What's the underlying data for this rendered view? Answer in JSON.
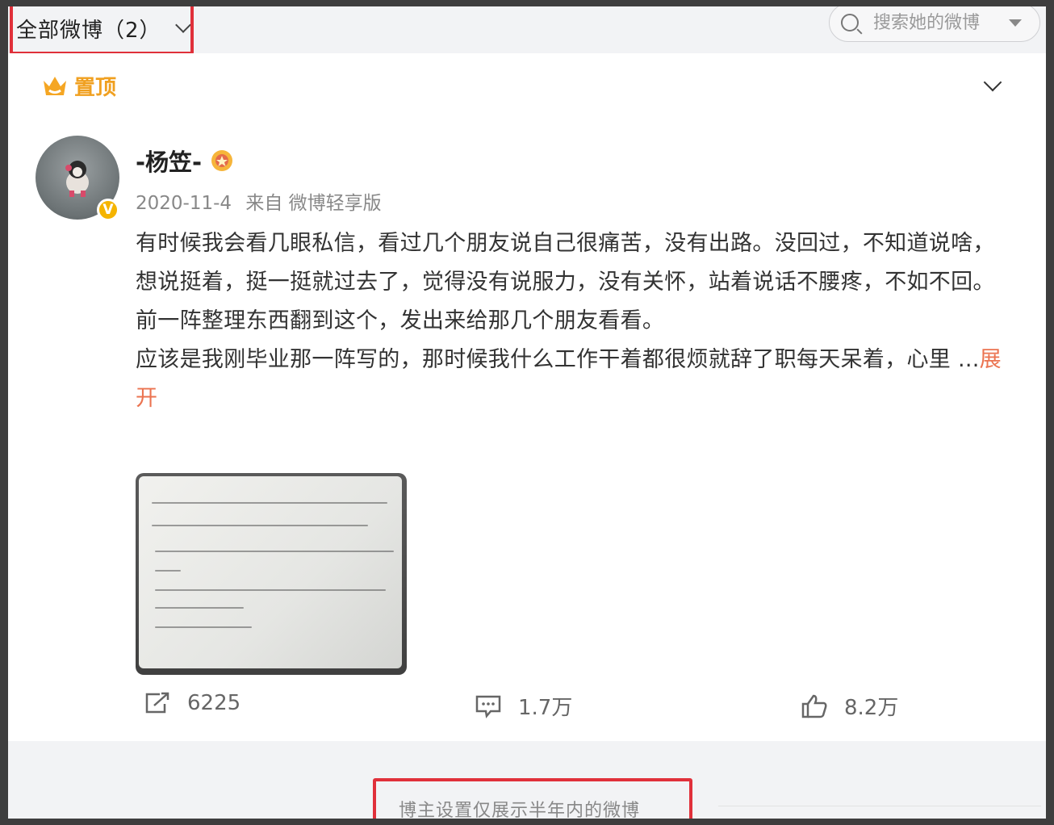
{
  "header": {
    "filter_label": "全部微博（2）",
    "search_placeholder": "搜索她的微博"
  },
  "post": {
    "pinned_label": "置顶",
    "username": "-杨笠-",
    "date": "2020-11-4",
    "source": "来自 微博轻享版",
    "text_lines": [
      "有时候我会看几眼私信，看过几个朋友说自己很痛苦，没有出路。没回过，不知道说啥，想说挺着，挺一挺就过去了，觉得没有说服力，没有关怀，站着说话不腰疼，不如不回。",
      "前一阵整理东西翻到这个，发出来给那几个朋友看看。",
      "应该是我刚毕业那一阵写的，那时候我什么工作干着都很烦就辞了职每天呆着，心里 ..."
    ],
    "expand_label": "展开",
    "verified_mark": "V",
    "actions": {
      "repost_count": "6225",
      "comment_count": "1.7万",
      "like_count": "8.2万"
    }
  },
  "footer": {
    "notice": "博主设置仅展示半年内的微博"
  },
  "colors": {
    "highlight_box": "#e0303a",
    "pinned": "#f0a020",
    "expand_link": "#eb7350",
    "verified_badge": "#f5b400"
  }
}
